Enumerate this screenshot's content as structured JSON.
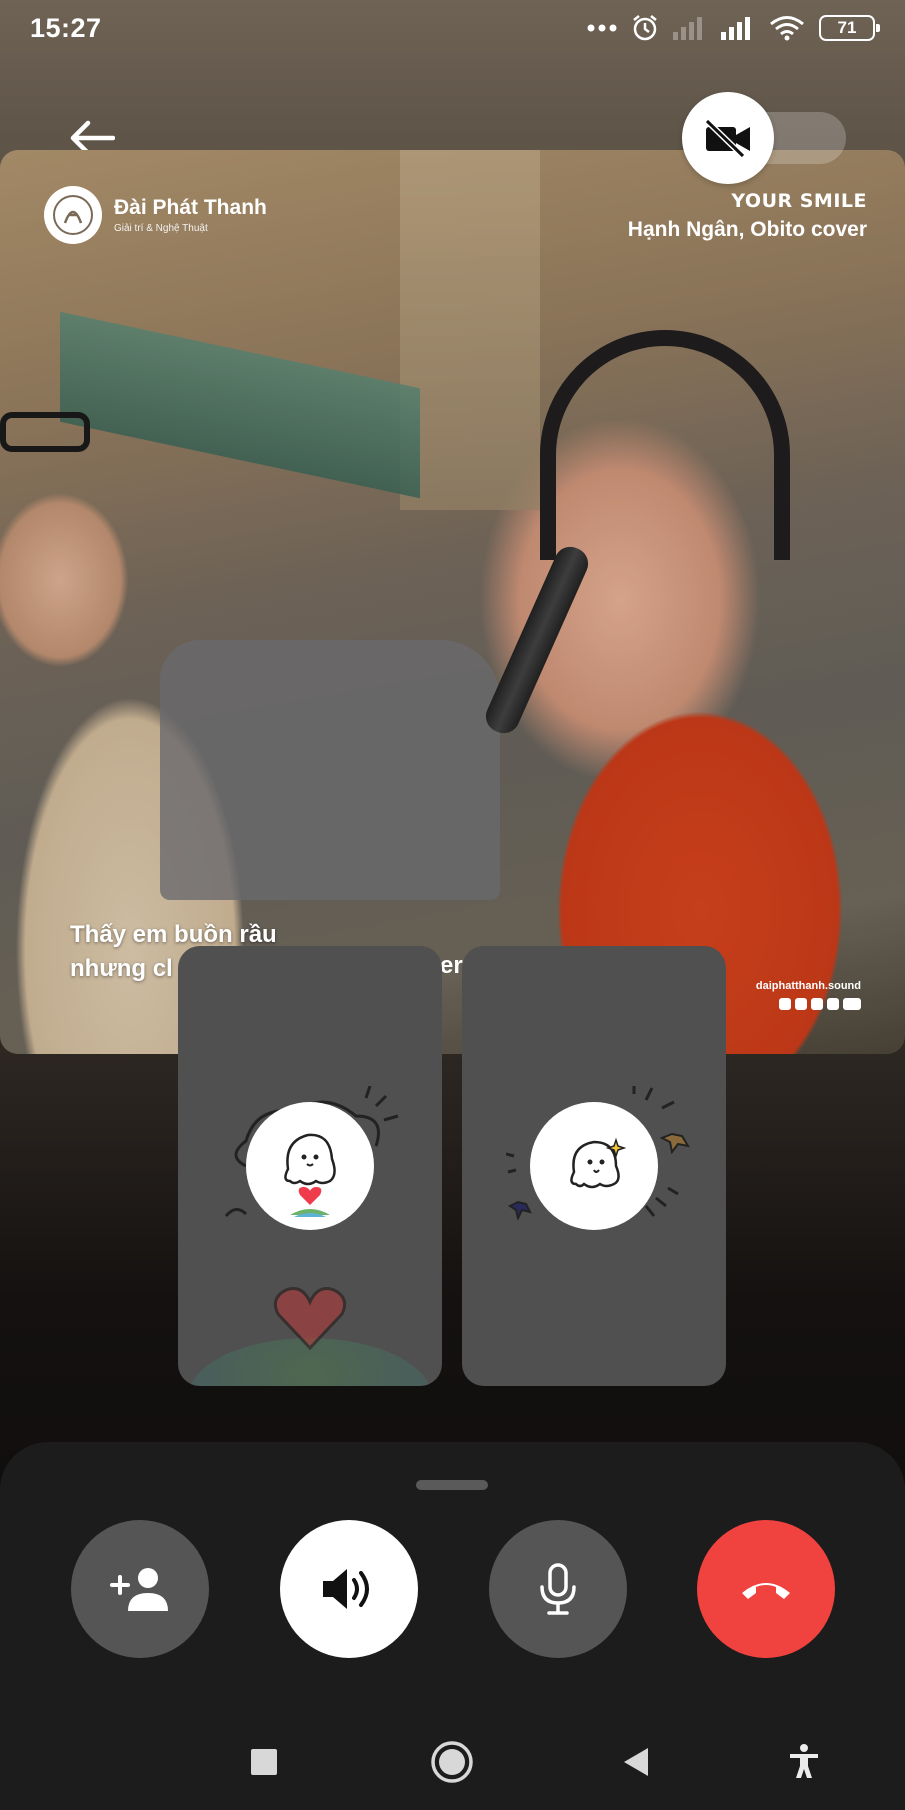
{
  "status_bar": {
    "time": "15:27",
    "battery": "71"
  },
  "icons": {
    "back": "arrow-left-icon",
    "camera_off": "video-off-icon",
    "add_participant": "person-add-icon",
    "speaker": "speaker-icon",
    "microphone": "microphone-icon",
    "end_call": "phone-hangup-icon"
  },
  "video": {
    "brand_name": "Đài Phát Thanh",
    "brand_sub": "Giải trí & Nghệ Thuật",
    "song_title": "YOUR SMILE",
    "song_artist": "Hạnh Ngân, Obito cover",
    "lyrics_line1": "Thấy em buồn rầu",
    "lyrics_line2": "nhưng cl",
    "lyrics_tail": "er",
    "channel_handle": "daiphatthanh.sound"
  },
  "colors": {
    "end_call": "#f0423e",
    "control_inactive": "#555555",
    "sheet_background": "#1c1c1c",
    "tile_background": "#505050"
  }
}
